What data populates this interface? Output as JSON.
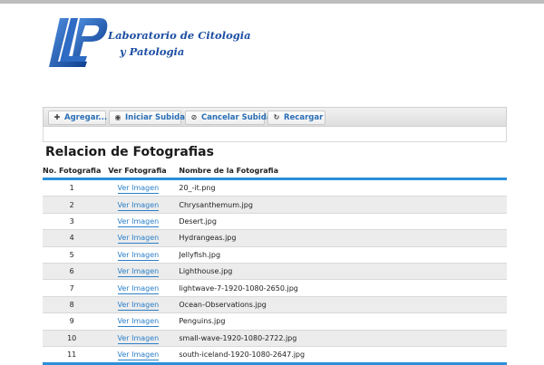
{
  "logo": {
    "line1": "Laboratorio de Citologia",
    "line2": "y Patologia"
  },
  "colors": {
    "accent": "#2a8fd8",
    "link": "#2a7fc9",
    "logo_blue": "#1e4fa3"
  },
  "toolbar": {
    "buttons": [
      {
        "icon": "plus-icon",
        "label": "Agregar..."
      },
      {
        "icon": "upload-circle-icon",
        "label": "Iniciar Subida"
      },
      {
        "icon": "cancel-icon",
        "label": "Cancelar Subida"
      },
      {
        "icon": "refresh-icon",
        "label": "Recargar"
      }
    ]
  },
  "section": {
    "title": "Relacion de Fotografias"
  },
  "table": {
    "headers": [
      "No. Fotografia",
      "Ver Fotografia",
      "Nombre de la Fotografia"
    ],
    "rows": [
      {
        "num": "1",
        "link": "Ver Imagen",
        "name": "20_-it.png"
      },
      {
        "num": "2",
        "link": "Ver Imagen",
        "name": "Chrysanthemum.jpg"
      },
      {
        "num": "3",
        "link": "Ver Imagen",
        "name": "Desert.jpg"
      },
      {
        "num": "4",
        "link": "Ver Imagen",
        "name": "Hydrangeas.jpg"
      },
      {
        "num": "5",
        "link": "Ver Imagen",
        "name": "Jellyfish.jpg"
      },
      {
        "num": "6",
        "link": "Ver Imagen",
        "name": "Lighthouse.jpg"
      },
      {
        "num": "7",
        "link": "Ver Imagen",
        "name": "lightwave-7-1920-1080-2650.jpg"
      },
      {
        "num": "8",
        "link": "Ver Imagen",
        "name": "Ocean-Observations.jpg"
      },
      {
        "num": "9",
        "link": "Ver Imagen",
        "name": "Penguins.jpg"
      },
      {
        "num": "10",
        "link": "Ver Imagen",
        "name": "small-wave-1920-1080-2722.jpg"
      },
      {
        "num": "11",
        "link": "Ver Imagen",
        "name": "south-iceland-1920-1080-2647.jpg"
      }
    ]
  }
}
